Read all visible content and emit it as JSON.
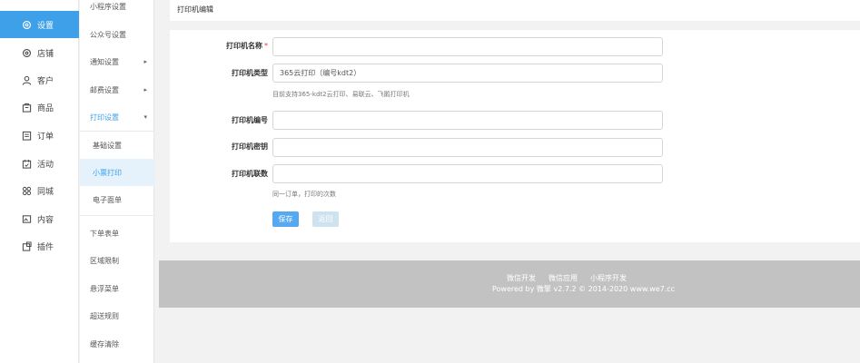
{
  "primary_nav": [
    {
      "label": "设置",
      "icon": "gear-icon",
      "active": true
    },
    {
      "label": "店铺",
      "icon": "store-icon",
      "active": false
    },
    {
      "label": "客户",
      "icon": "user-icon",
      "active": false
    },
    {
      "label": "商品",
      "icon": "bag-icon",
      "active": false
    },
    {
      "label": "订单",
      "icon": "list-icon",
      "active": false
    },
    {
      "label": "活动",
      "icon": "calendar-icon",
      "active": false
    },
    {
      "label": "同城",
      "icon": "grid-icon",
      "active": false
    },
    {
      "label": "内容",
      "icon": "image-icon",
      "active": false
    },
    {
      "label": "插件",
      "icon": "plugin-icon",
      "active": false
    }
  ],
  "secondary_nav": {
    "miniapp_settings": "小程序设置",
    "official_account_settings": "公众号设置",
    "notify_settings": "通知设置",
    "shipping_settings": "邮费设置",
    "print_settings": "打印设置",
    "print_basic": "基础设置",
    "receipt_print": "小票打印",
    "e_waybill": "电子面单",
    "order_form": "下单表单",
    "region_limit": "区域限制",
    "float_menu": "悬浮菜单",
    "delivery_rules": "超送规则",
    "cache_clear": "缓存清除",
    "arrow_right": "▸",
    "arrow_down": "▾"
  },
  "header": {
    "title": "打印机编辑"
  },
  "form": {
    "name_label": "打印机名称",
    "required_mark": "*",
    "name_value": "",
    "type_label": "打印机类型",
    "type_value": "365云打印（编号kdt2）",
    "type_help": "目前支持365-kdt2云打印、易联云、飞鹅打印机",
    "number_label": "打印机编号",
    "number_value": "",
    "key_label": "打印机密钥",
    "key_value": "",
    "copies_label": "打印机联数",
    "copies_value": "",
    "copies_help": "同一订单，打印的次数",
    "save_label": "保存",
    "back_label": "返回"
  },
  "footer": {
    "links": [
      "微信开发",
      "微信应用",
      "小程序开发"
    ],
    "copyright": "Powered by 微擎 v2.7.2 © 2014-2020 www.we7.cc"
  }
}
